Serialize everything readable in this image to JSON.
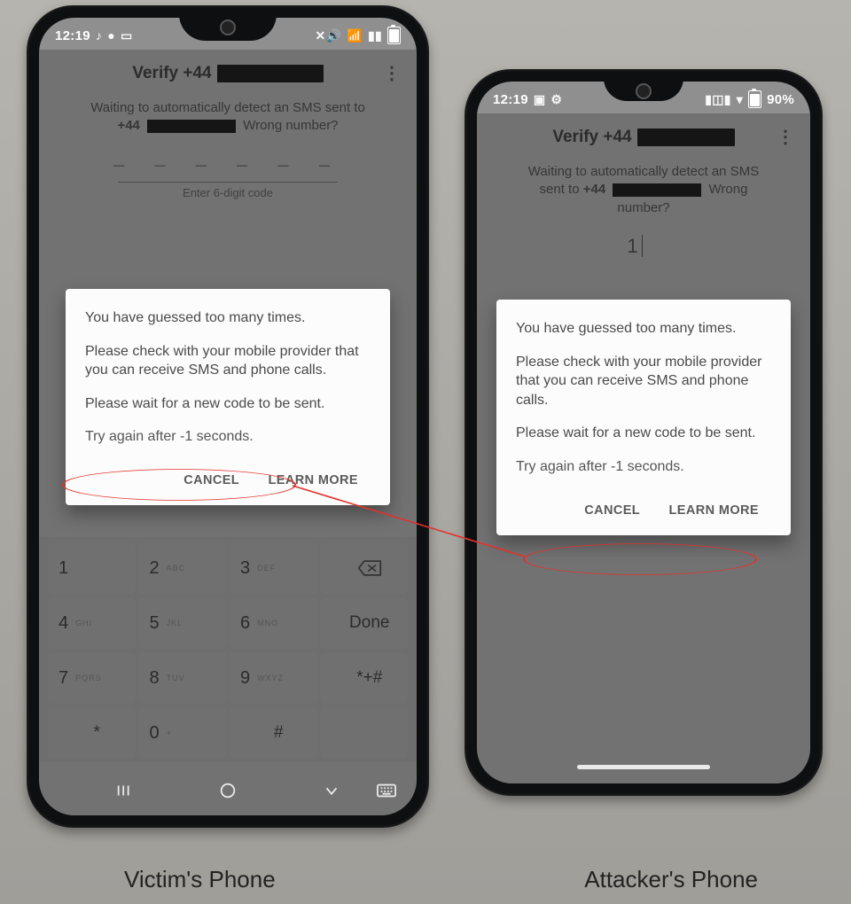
{
  "captions": {
    "left": "Victim's Phone",
    "right": "Attacker's Phone"
  },
  "left_phone": {
    "status": {
      "time": "12:19",
      "icons_left": [
        "♪",
        "●",
        "▭",
        "▭"
      ],
      "icons_right": [
        "🔇",
        "📶",
        "📶",
        "▮"
      ]
    },
    "verify": {
      "title_prefix": "Verify +44",
      "hint_line1": "Waiting to automatically detect an SMS sent to",
      "hint_num_prefix": "+44",
      "hint_wrong": "Wrong number?",
      "code_dashes": "– – –  – – –",
      "enter": "Enter 6-digit code",
      "typed": ""
    },
    "dialog": {
      "line1": "You have guessed too many times.",
      "line2": "Please check with your mobile provider that you can receive SMS and phone calls.",
      "line3": "Please wait for a new code to be sent.",
      "line4": "Try again after -1 seconds.",
      "cancel": "CANCEL",
      "learn": "LEARN MORE"
    },
    "keypad": {
      "k1": "1",
      "k2": "2",
      "k2s": "ABC",
      "k3": "3",
      "k3s": "DEF",
      "back": "⌫",
      "k4": "4",
      "k4s": "GHI",
      "k5": "5",
      "k5s": "JKL",
      "k6": "6",
      "k6s": "MNO",
      "done": "Done",
      "k7": "7",
      "k7s": "PQRS",
      "k8": "8",
      "k8s": "TUV",
      "k9": "9",
      "k9s": "WXYZ",
      "sym": "*+#",
      "star": "*",
      "k0": "0",
      "k0s": "+",
      "hash": "#",
      "blank": ""
    }
  },
  "right_phone": {
    "status": {
      "time": "12:19",
      "icons_left": [
        "▣",
        "⚙"
      ],
      "icons_right": [
        "📳",
        "▾",
        "90%"
      ],
      "battery_label": "90%"
    },
    "verify": {
      "title_prefix": "Verify +44",
      "hint_line1": "Waiting to automatically detect an SMS",
      "hint_line1b": "sent to",
      "hint_num_prefix": "+44",
      "hint_wrong": "Wrong",
      "hint_wrong2": "number?",
      "typed": "1"
    },
    "dialog": {
      "line1": "You have guessed too many times.",
      "line2": "Please check with your mobile provider that you can receive SMS and phone calls.",
      "line3": "Please wait for a new code to be sent.",
      "line4": "Try again after -1 seconds.",
      "cancel": "CANCEL",
      "learn": "LEARN MORE"
    }
  }
}
